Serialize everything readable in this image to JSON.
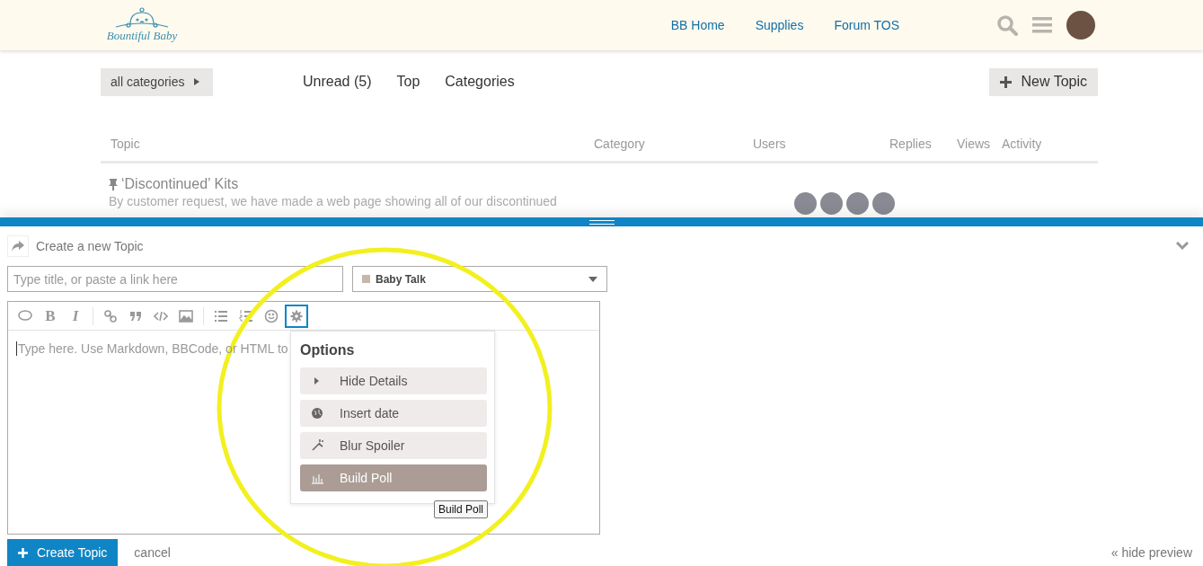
{
  "header": {
    "logo_text": "Bountiful Baby",
    "nav": [
      "BB Home",
      "Supplies",
      "Forum TOS"
    ]
  },
  "filters": {
    "category_dropdown": "all categories",
    "tabs": [
      {
        "label": "Unread (5)",
        "selected": false
      },
      {
        "label": "Top",
        "selected": false
      },
      {
        "label": "Categories",
        "selected": false
      }
    ],
    "new_topic_button": "New Topic"
  },
  "table": {
    "columns": [
      "Topic",
      "Category",
      "Users",
      "Replies",
      "Views",
      "Activity"
    ],
    "rows": [
      {
        "title": "‘Discontinued’ Kits",
        "pinned": true,
        "excerpt": "By customer request, we have made a web page showing all of our discontinued"
      }
    ]
  },
  "composer": {
    "title": "Create a new Topic",
    "title_field": {
      "placeholder": "Type title, or paste a link here"
    },
    "category": "Baby Talk",
    "toolbar": [
      {
        "kind": "speech",
        "selected": false
      },
      {
        "kind": "bold",
        "label": "B",
        "selected": false
      },
      {
        "kind": "italic",
        "label": "I",
        "selected": false
      },
      {
        "kind": "sep"
      },
      {
        "kind": "link",
        "selected": false
      },
      {
        "kind": "quote",
        "selected": false
      },
      {
        "kind": "code",
        "selected": false
      },
      {
        "kind": "image",
        "selected": false
      },
      {
        "kind": "sep"
      },
      {
        "kind": "bullets",
        "selected": false
      },
      {
        "kind": "numbers",
        "selected": false
      },
      {
        "kind": "emoji",
        "selected": false
      },
      {
        "kind": "gear",
        "selected": true
      }
    ],
    "editor": {
      "placeholder": "Type here. Use Markdown, BBCode, or HTML to"
    },
    "options_menu": {
      "title": "Options",
      "items": [
        {
          "label": "Hide Details",
          "kind": "caret",
          "selected": false
        },
        {
          "label": "Insert date",
          "kind": "globe",
          "selected": false
        },
        {
          "label": "Blur Spoiler",
          "kind": "wand",
          "selected": false
        },
        {
          "label": "Build Poll",
          "kind": "chart",
          "selected": true
        }
      ]
    },
    "tooltip": "Build Poll",
    "create_button": "Create Topic",
    "cancel": "cancel",
    "hide_preview": "« hide preview"
  }
}
